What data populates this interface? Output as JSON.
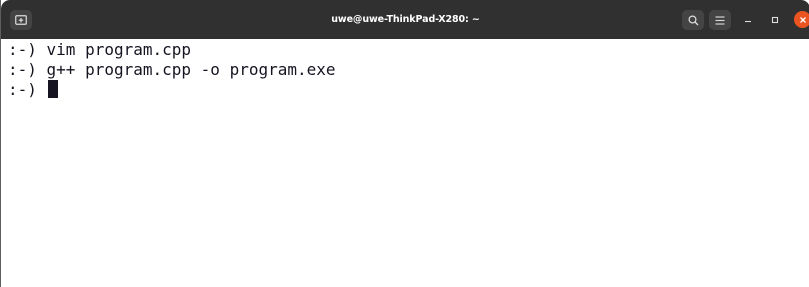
{
  "window": {
    "title": "uwe@uwe-ThinkPad-X280: ~"
  },
  "titlebar": {
    "icons": {
      "new_tab": "new-tab-icon",
      "search": "search-icon",
      "menu": "hamburger-menu-icon",
      "minimize": "minimize-icon",
      "maximize": "maximize-icon",
      "close": "close-icon"
    },
    "close_color": "#e95420",
    "bar_color": "#303030"
  },
  "terminal": {
    "lines": [
      {
        "prompt": ":-)",
        "command": " vim program.cpp"
      },
      {
        "prompt": ":-)",
        "command": " g++ program.cpp -o program.exe"
      },
      {
        "prompt": ":-)",
        "command": " "
      }
    ],
    "text_color": "#171421",
    "background": "#ffffff"
  }
}
